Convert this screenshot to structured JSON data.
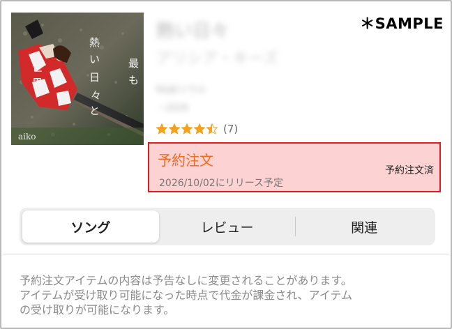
{
  "watermark": "＊SAMPLE",
  "album": {
    "title": "熱い日々",
    "artist": "アリシア・キーズ",
    "meta_line1": "R&B/ソウル",
    "meta_line2": "・2026"
  },
  "rating": {
    "stars": 4.5,
    "count_text": "(7)",
    "star_color": "#f4a11c"
  },
  "preorder": {
    "title": "予約注文",
    "release_text": "2026/10/02にリリース予定",
    "status": "予約注文済",
    "accent": "#f46a20",
    "border": "#e31b1b",
    "background": "#fcd2d2"
  },
  "tabs": [
    {
      "label": "ソング",
      "active": true
    },
    {
      "label": "レビュー",
      "active": false
    },
    {
      "label": "関連",
      "active": false
    }
  ],
  "notice": {
    "line1": "予約注文アイテムの内容は予告なしに変更されることがあります。",
    "line2": "アイテムが受け取り可能になった時点で代金が課金され、アイテム",
    "line3": "の受け取りが可能になります。"
  },
  "artwork": {
    "lettering": "最も 熱い日々 aiko",
    "icon": "album-cover"
  }
}
